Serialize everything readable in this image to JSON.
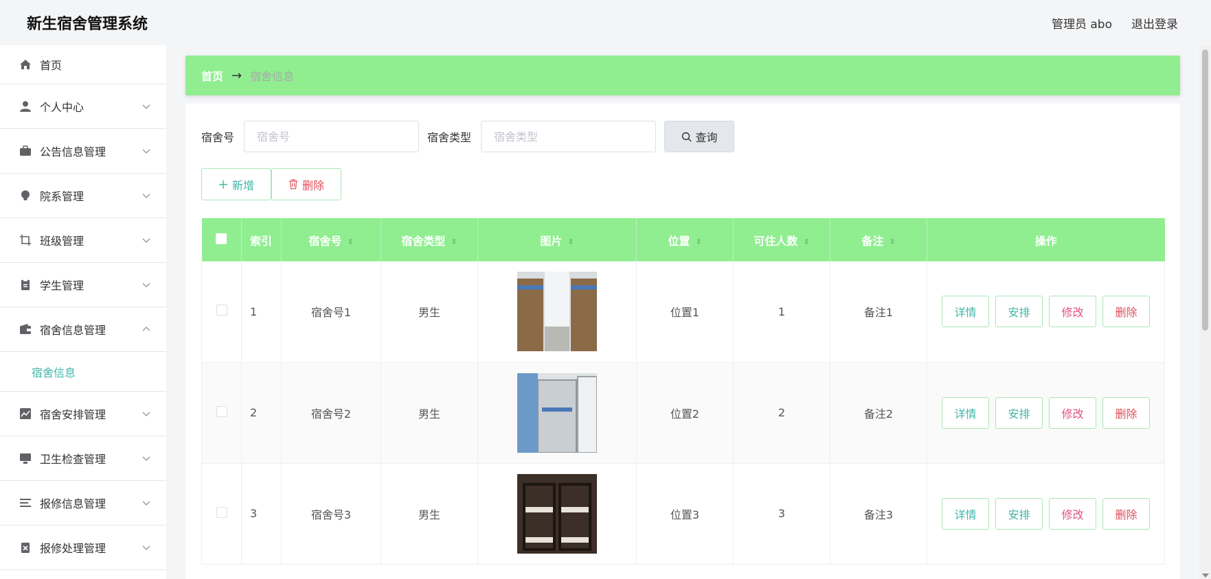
{
  "app": {
    "title": "新生宿舍管理系统"
  },
  "header": {
    "user_label": "管理员 abo",
    "logout_label": "退出登录"
  },
  "sidebar": {
    "items": [
      {
        "label": "首页",
        "icon": "home-icon"
      },
      {
        "label": "个人中心",
        "icon": "user-icon"
      },
      {
        "label": "公告信息管理",
        "icon": "briefcase-icon"
      },
      {
        "label": "院系管理",
        "icon": "bulb-icon"
      },
      {
        "label": "班级管理",
        "icon": "crop-icon"
      },
      {
        "label": "学生管理",
        "icon": "clipboard-icon"
      },
      {
        "label": "宿舍信息管理",
        "icon": "wallet-icon",
        "sub": "宿舍信息"
      },
      {
        "label": "宿舍安排管理",
        "icon": "chart-icon"
      },
      {
        "label": "卫生检查管理",
        "icon": "monitor-icon"
      },
      {
        "label": "报修信息管理",
        "icon": "list-icon"
      },
      {
        "label": "报修处理管理",
        "icon": "checklist-icon"
      }
    ]
  },
  "breadcrumb": {
    "home": "首页",
    "arrow": "→",
    "current": "宿舍信息"
  },
  "search": {
    "dorm_no_label": "宿舍号",
    "dorm_no_placeholder": "宿舍号",
    "dorm_no_value": "",
    "dorm_type_label": "宿舍类型",
    "dorm_type_placeholder": "宿舍类型",
    "dorm_type_value": "",
    "query_label": "查询"
  },
  "actions": {
    "add_label": "新增",
    "delete_label": "删除"
  },
  "table": {
    "headers": [
      "",
      "索引",
      "宿舍号",
      "宿舍类型",
      "图片",
      "位置",
      "可住人数",
      "备注",
      "操作"
    ],
    "rows": [
      {
        "index": "1",
        "dorm_no": "宿舍号1",
        "type": "男生",
        "location": "位置1",
        "capacity": "1",
        "remark": "备注1"
      },
      {
        "index": "2",
        "dorm_no": "宿舍号2",
        "type": "男生",
        "location": "位置2",
        "capacity": "2",
        "remark": "备注2"
      },
      {
        "index": "3",
        "dorm_no": "宿舍号3",
        "type": "男生",
        "location": "位置3",
        "capacity": "3",
        "remark": "备注3"
      }
    ],
    "ops": {
      "detail": "详情",
      "arrange": "安排",
      "edit": "修改",
      "delete": "删除"
    }
  },
  "colors": {
    "header_green": "#90ee90",
    "accent_teal": "#3fb6a8",
    "danger_red": "#e0505c",
    "edit_pink": "#e2507e"
  }
}
